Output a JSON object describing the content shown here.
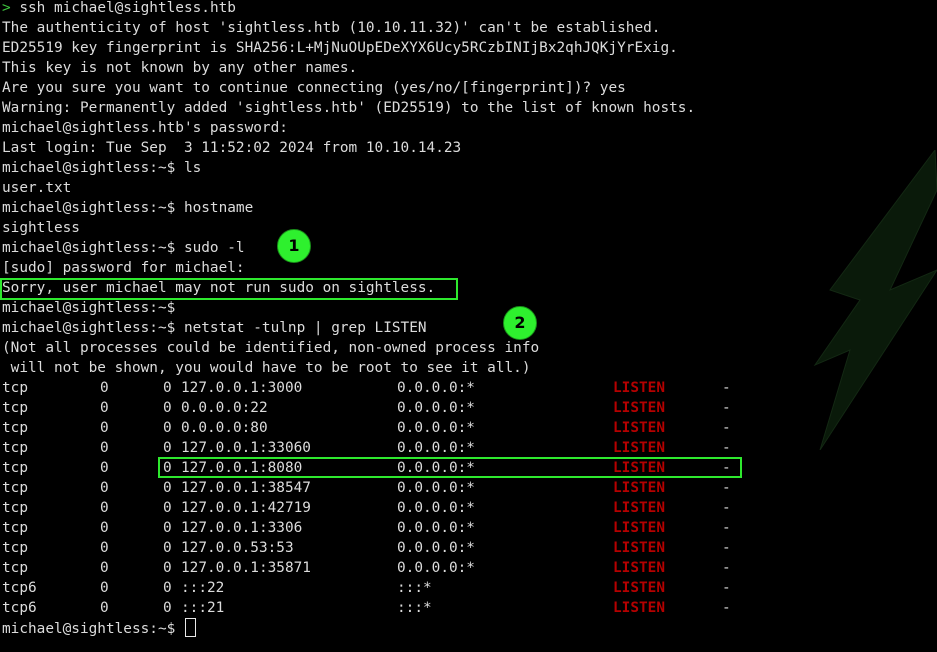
{
  "prompt_symbol": ">",
  "colors": {
    "background": "#000000",
    "text": "#dcdcdc",
    "listen": "#b40000",
    "highlight": "#2ee82e",
    "badge": "#2ef02e"
  },
  "intro_lines": [
    "ssh michael@sightless.htb",
    "The authenticity of host 'sightless.htb (10.10.11.32)' can't be established.",
    "ED25519 key fingerprint is SHA256:L+MjNuOUpEDeXYX6Ucy5RCzbINIjBx2qhJQKjYrExig.",
    "This key is not known by any other names.",
    "Are you sure you want to continue connecting (yes/no/[fingerprint])? yes",
    "Warning: Permanently added 'sightless.htb' (ED25519) to the list of known hosts.",
    "michael@sightless.htb's password:",
    "Last login: Tue Sep  3 11:52:02 2024 from 10.10.14.23",
    "michael@sightless:~$ ls",
    "user.txt",
    "michael@sightless:~$ hostname",
    "sightless",
    "michael@sightless:~$ sudo -l",
    "[sudo] password for michael:",
    "Sorry, user michael may not run sudo on sightless.",
    "michael@sightless:~$",
    "michael@sightless:~$ netstat -tulnp | grep LISTEN",
    "(Not all processes could be identified, non-owned process info",
    " will not be shown, you would have to be root to see it all.)"
  ],
  "netstat_rows": [
    {
      "proto": "tcp",
      "recvq": "0",
      "sendq": "0",
      "local": "127.0.0.1:3000",
      "foreign": "0.0.0.0:*",
      "state": "LISTEN",
      "pid": "-"
    },
    {
      "proto": "tcp",
      "recvq": "0",
      "sendq": "0",
      "local": "0.0.0.0:22",
      "foreign": "0.0.0.0:*",
      "state": "LISTEN",
      "pid": "-"
    },
    {
      "proto": "tcp",
      "recvq": "0",
      "sendq": "0",
      "local": "0.0.0.0:80",
      "foreign": "0.0.0.0:*",
      "state": "LISTEN",
      "pid": "-"
    },
    {
      "proto": "tcp",
      "recvq": "0",
      "sendq": "0",
      "local": "127.0.0.1:33060",
      "foreign": "0.0.0.0:*",
      "state": "LISTEN",
      "pid": "-"
    },
    {
      "proto": "tcp",
      "recvq": "0",
      "sendq": "0",
      "local": "127.0.0.1:8080",
      "foreign": "0.0.0.0:*",
      "state": "LISTEN",
      "pid": "-"
    },
    {
      "proto": "tcp",
      "recvq": "0",
      "sendq": "0",
      "local": "127.0.0.1:38547",
      "foreign": "0.0.0.0:*",
      "state": "LISTEN",
      "pid": "-"
    },
    {
      "proto": "tcp",
      "recvq": "0",
      "sendq": "0",
      "local": "127.0.0.1:42719",
      "foreign": "0.0.0.0:*",
      "state": "LISTEN",
      "pid": "-"
    },
    {
      "proto": "tcp",
      "recvq": "0",
      "sendq": "0",
      "local": "127.0.0.1:3306",
      "foreign": "0.0.0.0:*",
      "state": "LISTEN",
      "pid": "-"
    },
    {
      "proto": "tcp",
      "recvq": "0",
      "sendq": "0",
      "local": "127.0.0.53:53",
      "foreign": "0.0.0.0:*",
      "state": "LISTEN",
      "pid": "-"
    },
    {
      "proto": "tcp",
      "recvq": "0",
      "sendq": "0",
      "local": "127.0.0.1:35871",
      "foreign": "0.0.0.0:*",
      "state": "LISTEN",
      "pid": "-"
    },
    {
      "proto": "tcp6",
      "recvq": "0",
      "sendq": "0",
      "local": ":::22",
      "foreign": ":::*",
      "state": "LISTEN",
      "pid": "-"
    },
    {
      "proto": "tcp6",
      "recvq": "0",
      "sendq": "0",
      "local": ":::21",
      "foreign": ":::*",
      "state": "LISTEN",
      "pid": "-"
    }
  ],
  "final_prompt": "michael@sightless:~$",
  "annotations": {
    "badge_1": "1",
    "badge_2": "2"
  }
}
